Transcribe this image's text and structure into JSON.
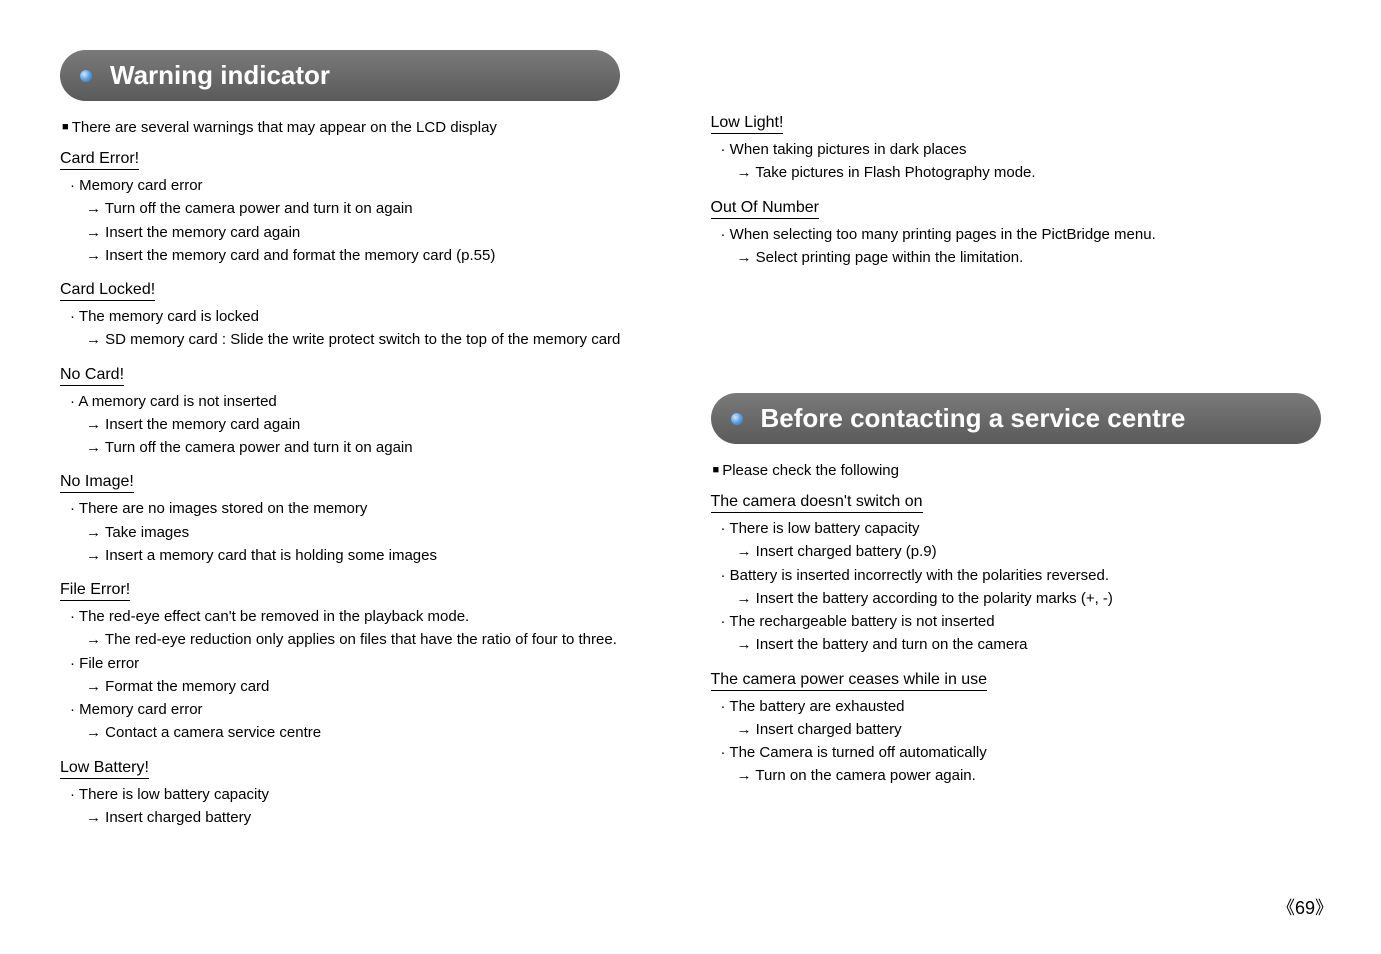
{
  "page_number": "69",
  "left_section_title": "Warning indicator",
  "left_intro": "There are several warnings that may appear on the LCD display",
  "left_topics": [
    {
      "title": "Card Error!",
      "lines": [
        {
          "type": "cause",
          "text": "Memory card error"
        },
        {
          "type": "action",
          "text": "Turn off the camera power and turn it on again"
        },
        {
          "type": "action",
          "text": "Insert the memory card again"
        },
        {
          "type": "action",
          "text": "Insert the memory card and format the memory card (p.55)"
        }
      ]
    },
    {
      "title": "Card Locked!",
      "lines": [
        {
          "type": "cause",
          "text": "The memory card is locked"
        },
        {
          "type": "action",
          "text": "SD memory card : Slide the write protect switch to the top of the memory card"
        }
      ]
    },
    {
      "title": "No Card!",
      "lines": [
        {
          "type": "cause",
          "text": "A memory card is not inserted"
        },
        {
          "type": "action",
          "text": "Insert the memory card again"
        },
        {
          "type": "action",
          "text": "Turn off the camera power and turn it on again"
        }
      ]
    },
    {
      "title": "No Image!",
      "lines": [
        {
          "type": "cause",
          "text": "There are no images stored on the memory"
        },
        {
          "type": "action",
          "text": "Take images"
        },
        {
          "type": "action",
          "text": "Insert a memory card that is holding some images"
        }
      ]
    },
    {
      "title": "File Error!",
      "lines": [
        {
          "type": "cause",
          "text": "The red-eye effect can't be removed in the playback mode."
        },
        {
          "type": "action",
          "text": "The red-eye reduction only applies on  files that have the ratio of four to three."
        },
        {
          "type": "cause",
          "text": "File error"
        },
        {
          "type": "action",
          "text": "Format the memory card"
        },
        {
          "type": "cause",
          "text": "Memory card error"
        },
        {
          "type": "action",
          "text": "Contact a camera service centre"
        }
      ]
    },
    {
      "title": "Low Battery!",
      "lines": [
        {
          "type": "cause",
          "text": "There is low battery capacity"
        },
        {
          "type": "action",
          "text": "Insert charged battery"
        }
      ]
    }
  ],
  "right_top_topics": [
    {
      "title": "Low Light!",
      "lines": [
        {
          "type": "cause",
          "text": "When taking pictures in dark places"
        },
        {
          "type": "action",
          "text": "Take pictures in Flash Photography mode."
        }
      ]
    },
    {
      "title": "Out Of Number",
      "lines": [
        {
          "type": "cause",
          "text": " When selecting too many printing pages in the PictBridge menu."
        },
        {
          "type": "action",
          "text": "Select printing page within the limitation."
        }
      ]
    }
  ],
  "right_section_title": "Before contacting a service centre",
  "right_intro": "Please check the following",
  "right_bottom_topics": [
    {
      "title": "The camera doesn't switch on",
      "lines": [
        {
          "type": "cause",
          "text": "There is low battery capacity"
        },
        {
          "type": "action",
          "text": "Insert charged battery (p.9)"
        },
        {
          "type": "cause",
          "text": "Battery is inserted incorrectly with the polarities reversed."
        },
        {
          "type": "action",
          "text": "Insert the battery according to the polarity marks (+, -)"
        },
        {
          "type": "cause",
          "text": "The rechargeable battery is not inserted"
        },
        {
          "type": "action",
          "text": "Insert the battery and turn on the camera"
        }
      ]
    },
    {
      "title": "The camera power ceases while in use",
      "lines": [
        {
          "type": "cause",
          "text": "The battery are exhausted"
        },
        {
          "type": "action",
          "text": "Insert charged battery"
        },
        {
          "type": "cause",
          "text": "The Camera is turned off automatically"
        },
        {
          "type": "action",
          "text": "Turn on the camera power again."
        }
      ]
    }
  ]
}
